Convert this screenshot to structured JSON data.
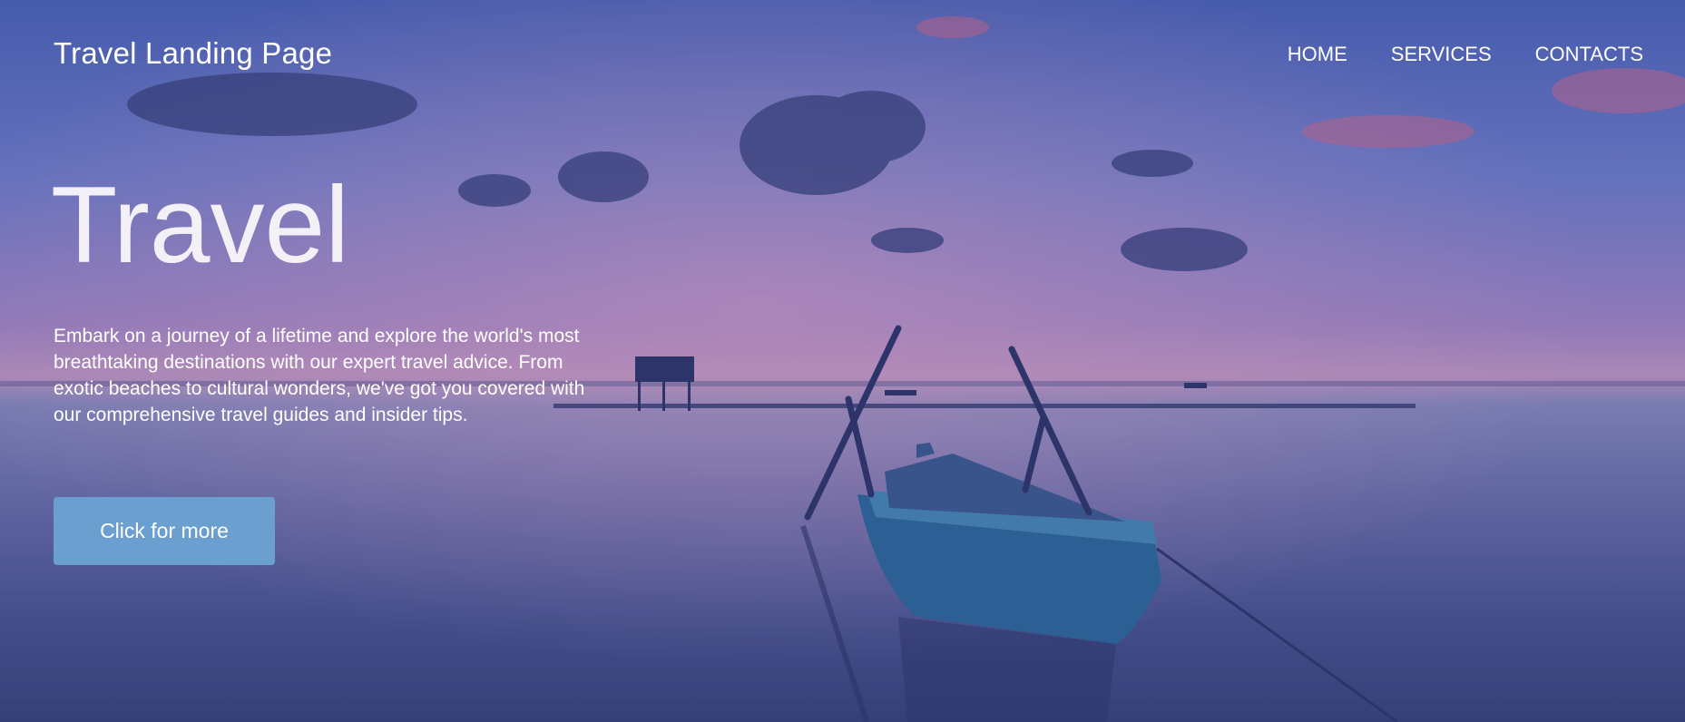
{
  "header": {
    "brand": "Travel Landing Page",
    "nav": [
      "HOME",
      "SERVICES",
      "CONTACTS"
    ]
  },
  "hero": {
    "title": "Travel",
    "description": "Embark on a journey of a lifetime and explore the world's most breathtaking destinations with our expert travel advice. From exotic beaches to cultural wonders, we've got you covered with our comprehensive travel guides and insider tips.",
    "cta_label": "Click for more",
    "background_image": "sunset-lake-with-wooden-boat"
  },
  "colors": {
    "button": "#6a9fd0",
    "text": "#ffffff"
  }
}
